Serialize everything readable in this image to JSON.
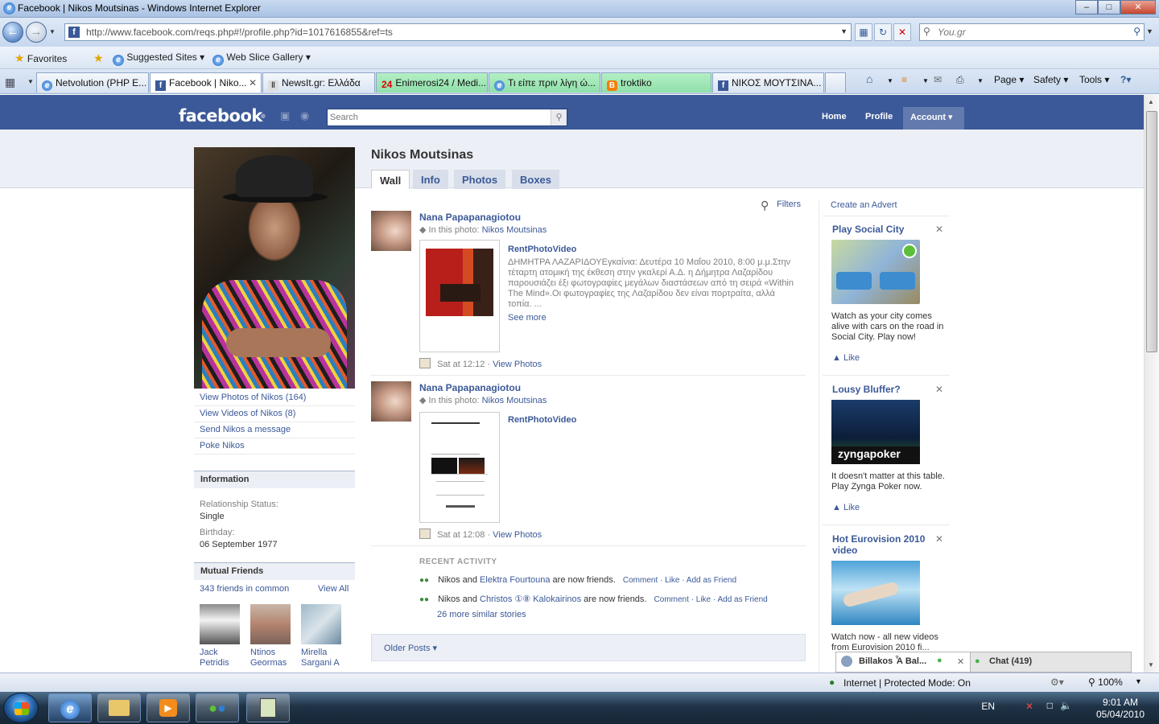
{
  "window": {
    "title": "Facebook | Nikos Moutsinas - Windows Internet Explorer",
    "minimize": "–",
    "maximize": "□",
    "close": "✕"
  },
  "address_bar": {
    "url": "http://www.facebook.com/reqs.php#!/profile.php?id=1017616855&ref=ts",
    "search_placeholder": "You.gr"
  },
  "favorites_bar": {
    "favorites_label": "Favorites",
    "items": [
      "Suggested Sites ▾",
      "Web Slice Gallery ▾"
    ]
  },
  "tabs": [
    {
      "label": "Netvolution (PHP E...",
      "icon": "ie-icon"
    },
    {
      "label": "Facebook | Niko...",
      "icon": "facebook-icon",
      "active": true
    },
    {
      "label": "NewsIt.gr: Ελλάδα",
      "icon": "newsit-icon"
    },
    {
      "label": "Enimerosi24 / Medi...",
      "icon": "enimerosi-icon",
      "prefix": "24"
    },
    {
      "label": "Τι είπε πριν λίγη ώ...",
      "icon": "ie-icon"
    },
    {
      "label": "troktiko",
      "icon": "blogger-icon"
    },
    {
      "label": "ΝΙΚΟΣ ΜΟΥΤΣΙΝΑ...",
      "icon": "facebook-icon"
    }
  ],
  "command_bar": {
    "page": "Page ▾",
    "safety": "Safety ▾",
    "tools": "Tools ▾"
  },
  "facebook": {
    "logo": "facebook",
    "search_placeholder": "Search",
    "nav": {
      "home": "Home",
      "profile": "Profile",
      "account": "Account ▾"
    },
    "profile_name": "Nikos Moutsinas",
    "profile_tabs": [
      "Wall",
      "Info",
      "Photos",
      "Boxes"
    ],
    "left_links": [
      "View Photos of Nikos (164)",
      "View Videos of Nikos (8)",
      "Send Nikos a message",
      "Poke Nikos"
    ],
    "information": {
      "heading": "Information",
      "relationship_label": "Relationship Status:",
      "relationship_value": "Single",
      "birthday_label": "Birthday:",
      "birthday_value": "06 September 1977"
    },
    "mutual_friends": {
      "heading": "Mutual Friends",
      "count": "343 friends in common",
      "view_all": "View All",
      "friends": [
        {
          "line1": "Jack",
          "line2": "Petridis"
        },
        {
          "line1": "Ntinos",
          "line2": "Geormas"
        },
        {
          "line1": "Mirella",
          "line2": "Sargani A"
        }
      ]
    },
    "filters": "Filters",
    "posts": [
      {
        "author": "Nana Papapanagiotou",
        "in_photo_label": "In this photo:",
        "in_photo_name": "Nikos Moutsinas",
        "attachment_title": "RentPhotoVideo",
        "description": "ΔΗΜΗΤΡΑ ΛΑΖΑΡΙΔΟΥΕγκαίνια: Δευτέρα 10 Μαΐου 2010, 8:00 μ.μ.Στην τέταρτη ατομική της έκθεση στην γκαλερί Α.Δ. η Δήμητρα Λαζαρίδου παρουσιάζει έξι φωτογραφίες μεγάλων διαστάσεων από τη σειρά «Within The Mind».Οι φωτογραφίες της Λαζαρίδου δεν είναι πορτραίτα, αλλά τοπία. ...",
        "see_more": "See more",
        "time": "Sat at 12:12 ·",
        "view_photos": "View Photos"
      },
      {
        "author": "Nana Papapanagiotou",
        "in_photo_label": "In this photo:",
        "in_photo_name": "Nikos Moutsinas",
        "attachment_title": "RentPhotoVideo",
        "time": "Sat at 12:08 ·",
        "view_photos": "View Photos"
      }
    ],
    "recent_activity": {
      "heading": "RECENT ACTIVITY",
      "items": [
        {
          "prefix": "Nikos and",
          "friend": "Elektra Fourtouna",
          "suffix": "are now friends.",
          "actions": "Comment · Like · Add as Friend"
        },
        {
          "prefix": "Nikos and",
          "friend": "Christos ①⑧ Kalokairinos",
          "suffix": "are now friends.",
          "actions": "Comment · Like · Add as Friend"
        }
      ],
      "more": "26 more similar stories"
    },
    "older_posts": "Older Posts ▾",
    "ads": {
      "create": "Create an Advert",
      "items": [
        {
          "title": "Play Social City",
          "text": "Watch as your city comes alive with cars on the road in Social City. Play now!",
          "like": "Like"
        },
        {
          "title": "Lousy Bluffer?",
          "text": "It doesn't matter at this table. Play Zynga Poker now.",
          "like": "Like",
          "brand": "zyngapoker"
        },
        {
          "title": "Hot Eurovision 2010 video",
          "text": "Watch now - all new videos from Eurovision 2010 fi..."
        }
      ]
    },
    "chat": {
      "tab_user": "Billakos Ἇ Bal...",
      "chat_label": "Chat (419)"
    }
  },
  "status_bar": {
    "zone": "Internet | Protected Mode: On",
    "zoom": "100%"
  },
  "taskbar": {
    "language": "EN",
    "time": "9:01 AM",
    "date": "05/04/2010"
  }
}
